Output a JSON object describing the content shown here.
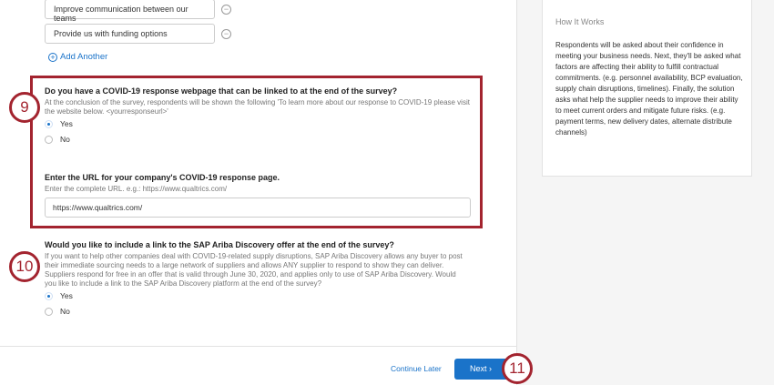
{
  "options": [
    "Improve communication between our teams",
    "Provide us with funding options"
  ],
  "add_another": "Add Another",
  "q9": {
    "title": "Do you have a COVID-19 response webpage that can be linked to at the end of the survey?",
    "desc": "At the conclusion of the survey, respondents will be shown the following 'To learn more about our response to COVID-19 please visit the website below. <yourresponseurl>'",
    "yes": "Yes",
    "no": "No",
    "selected": "Yes",
    "url_label": "Enter the URL for your company's COVID-19 response page.",
    "url_hint": "Enter the complete URL. e.g.: https://www.qualtrics.com/",
    "url_value": "https://www.qualtrics.com/"
  },
  "q10": {
    "title": "Would you like to include a link to the SAP Ariba Discovery offer at the end of the survey?",
    "desc": "If you want to help other companies deal with COVID-19-related supply disruptions, SAP Ariba Discovery allows any buyer to post their immediate sourcing needs to a large network of suppliers and allows ANY supplier to respond to show they can deliver. Suppliers respond for free in an offer that is valid through June 30, 2020, and applies only to use of SAP Ariba Discovery. Would you like to include a link to the SAP Ariba Discovery platform at the end of the survey?",
    "yes": "Yes",
    "no": "No",
    "selected": "Yes"
  },
  "footer": {
    "continue_later": "Continue Later",
    "next": "Next"
  },
  "callouts": [
    "9",
    "10",
    "11"
  ],
  "how_it_works": {
    "title": "How It Works",
    "body": "Respondents will be asked about their confidence in meeting your business needs. Next, they'll be asked what factors are affecting their ability to fulfill contractual commitments. (e.g. personnel availability, BCP evaluation, supply chain disruptions, timelines). Finally, the solution asks what help the supplier needs to improve their ability to meet current orders and mitigate future risks. (e.g. payment terms, new delivery dates, alternate distribute channels)"
  },
  "colors": {
    "accent": "#1a73c9",
    "callout": "#a3242f"
  }
}
